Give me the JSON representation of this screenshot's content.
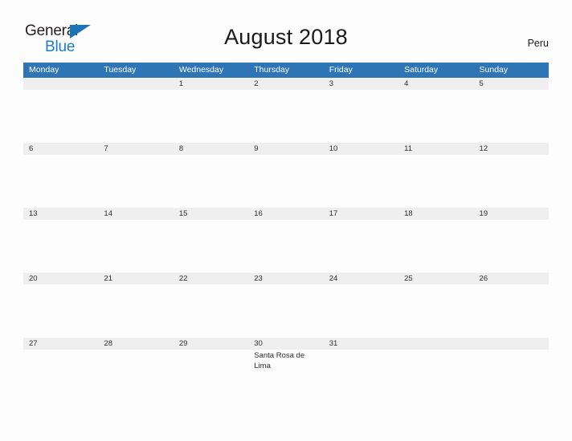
{
  "logo": {
    "word_one": "General",
    "word_two": "Blue",
    "flag_icon": "triangle-flag-icon",
    "brand_blue": "#1a7cc1"
  },
  "header": {
    "title": "August 2018",
    "country": "Peru"
  },
  "calendar": {
    "header_bg": "#2f75b5",
    "band_bg": "#efefef",
    "weekdays": [
      "Monday",
      "Tuesday",
      "Wednesday",
      "Thursday",
      "Friday",
      "Saturday",
      "Sunday"
    ],
    "weeks": [
      [
        {
          "day": "",
          "holiday": ""
        },
        {
          "day": "",
          "holiday": ""
        },
        {
          "day": "1",
          "holiday": ""
        },
        {
          "day": "2",
          "holiday": ""
        },
        {
          "day": "3",
          "holiday": ""
        },
        {
          "day": "4",
          "holiday": ""
        },
        {
          "day": "5",
          "holiday": ""
        }
      ],
      [
        {
          "day": "6",
          "holiday": ""
        },
        {
          "day": "7",
          "holiday": ""
        },
        {
          "day": "8",
          "holiday": ""
        },
        {
          "day": "9",
          "holiday": ""
        },
        {
          "day": "10",
          "holiday": ""
        },
        {
          "day": "11",
          "holiday": ""
        },
        {
          "day": "12",
          "holiday": ""
        }
      ],
      [
        {
          "day": "13",
          "holiday": ""
        },
        {
          "day": "14",
          "holiday": ""
        },
        {
          "day": "15",
          "holiday": ""
        },
        {
          "day": "16",
          "holiday": ""
        },
        {
          "day": "17",
          "holiday": ""
        },
        {
          "day": "18",
          "holiday": ""
        },
        {
          "day": "19",
          "holiday": ""
        }
      ],
      [
        {
          "day": "20",
          "holiday": ""
        },
        {
          "day": "21",
          "holiday": ""
        },
        {
          "day": "22",
          "holiday": ""
        },
        {
          "day": "23",
          "holiday": ""
        },
        {
          "day": "24",
          "holiday": ""
        },
        {
          "day": "25",
          "holiday": ""
        },
        {
          "day": "26",
          "holiday": ""
        }
      ],
      [
        {
          "day": "27",
          "holiday": ""
        },
        {
          "day": "28",
          "holiday": ""
        },
        {
          "day": "29",
          "holiday": ""
        },
        {
          "day": "30",
          "holiday": "Santa Rosa de Lima"
        },
        {
          "day": "31",
          "holiday": ""
        },
        {
          "day": "",
          "holiday": ""
        },
        {
          "day": "",
          "holiday": ""
        }
      ]
    ]
  }
}
